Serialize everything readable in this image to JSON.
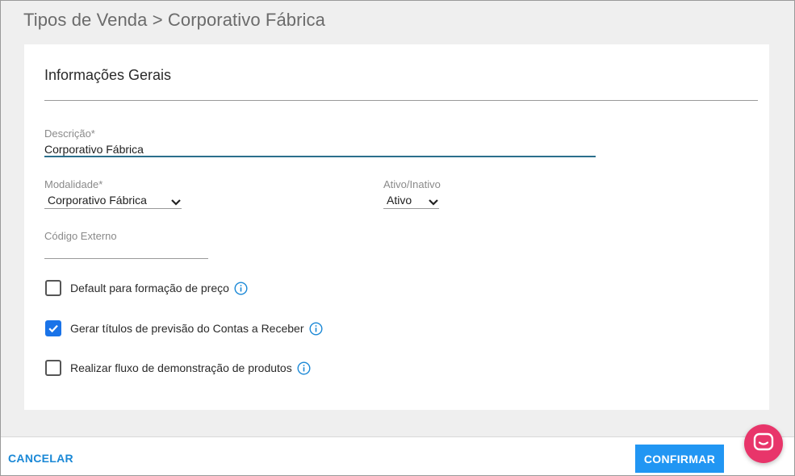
{
  "breadcrumb": {
    "parent": "Tipos de Venda",
    "separator": ">",
    "current": "Corporativo Fábrica"
  },
  "section": {
    "title": "Informações Gerais"
  },
  "fields": {
    "descricao": {
      "label": "Descrição*",
      "value": "Corporativo Fábrica"
    },
    "modalidade": {
      "label": "Modalidade*",
      "value": "Corporativo Fábrica"
    },
    "ativo": {
      "label": "Ativo/Inativo",
      "value": "Ativo"
    },
    "codigo_externo": {
      "label": "Código Externo",
      "value": ""
    }
  },
  "checkboxes": [
    {
      "label": "Default para formação de preço",
      "checked": false,
      "icon": "info-icon"
    },
    {
      "label": "Gerar títulos de previsão do Contas a Receber",
      "checked": true,
      "icon": "info-icon"
    },
    {
      "label": "Realizar fluxo de demonstração de produtos",
      "checked": false,
      "icon": "info-icon"
    }
  ],
  "footer": {
    "cancel_label": "CANCELAR",
    "confirm_label": "CONFIRMAR"
  },
  "colors": {
    "accent": "#2196f3",
    "link": "#1a88d6",
    "chat": "#e8356a",
    "input_active": "#2b6f8c"
  },
  "chat": {
    "icon": "chat-icon"
  }
}
